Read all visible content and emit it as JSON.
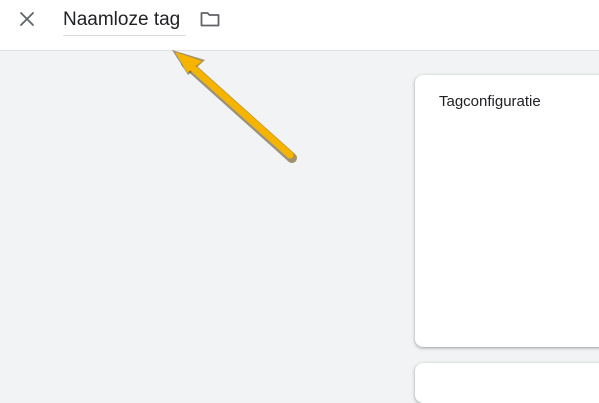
{
  "header": {
    "close_icon": "close-icon",
    "tag_name": "Naamloze tag",
    "folder_icon": "folder-icon"
  },
  "config_card": {
    "title": "Tagconfiguratie"
  },
  "annotation": {
    "arrow_color": "#f4b400",
    "arrow_outline": "#5f4300"
  }
}
